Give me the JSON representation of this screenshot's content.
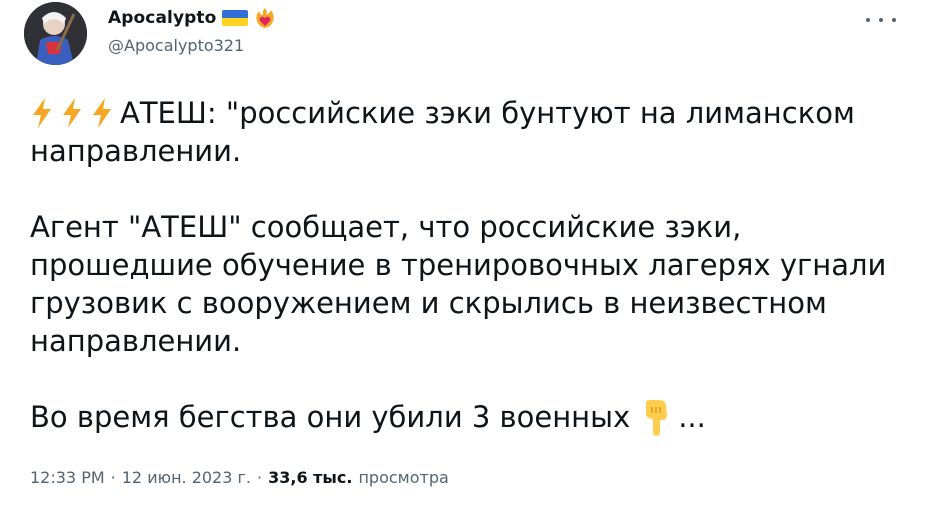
{
  "author": {
    "display_name": "Apocalypto",
    "handle": "@Apocalypto321",
    "badges": [
      "ukraine-flag-icon",
      "fire-heart-icon"
    ],
    "flag_colors": {
      "top": "#2f6fd6",
      "bottom": "#ffd21f"
    }
  },
  "tweet": {
    "line1_text": "АТЕШ: \"российские зэки бунтуют на лиманском направлении.",
    "paragraph2": "Агент \"АТЕШ\" сообщает, что российские зэки, прошедшие обучение в тренировочных лагерях угнали грузовик с вооружением и скрылись в неизвестном направлении.",
    "paragraph3_text": "Во время бегства они убили 3 военных",
    "paragraph3_suffix": "...",
    "emoji_icons": [
      "lightning-icon",
      "lightning-icon",
      "lightning-icon",
      "backhand-index-pointing-down-icon"
    ]
  },
  "meta": {
    "time": "12:33 PM",
    "sep1": "·",
    "date": "12 июн. 2023 г.",
    "sep2": "·",
    "views_count": "33,6 тыс.",
    "views_label": "просмотра"
  },
  "colors": {
    "text": "#0f1419",
    "secondary": "#536471",
    "background": "#ffffff",
    "bolt": "#f5a623"
  }
}
